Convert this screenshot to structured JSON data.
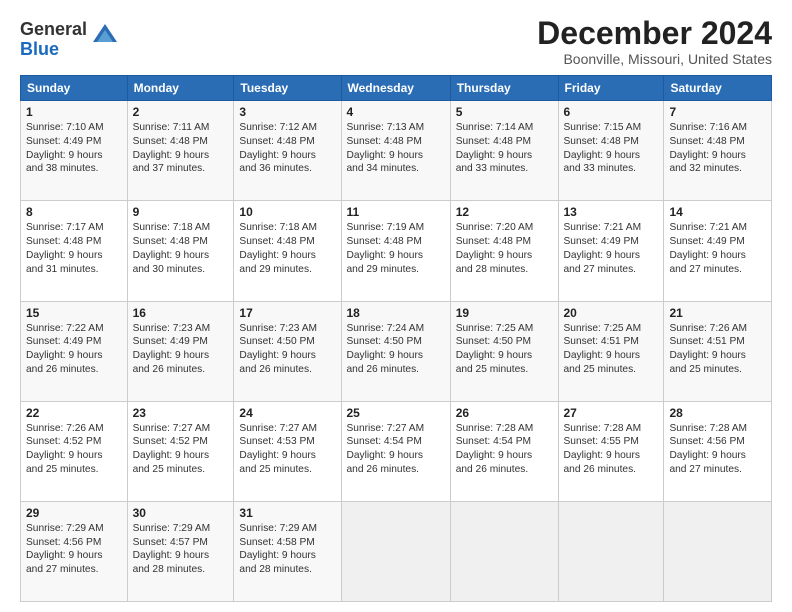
{
  "logo": {
    "general": "General",
    "blue": "Blue"
  },
  "header": {
    "title": "December 2024",
    "subtitle": "Boonville, Missouri, United States"
  },
  "days": [
    "Sunday",
    "Monday",
    "Tuesday",
    "Wednesday",
    "Thursday",
    "Friday",
    "Saturday"
  ],
  "weeks": [
    [
      {
        "num": "1",
        "info": "Sunrise: 7:10 AM\nSunset: 4:49 PM\nDaylight: 9 hours\nand 38 minutes."
      },
      {
        "num": "2",
        "info": "Sunrise: 7:11 AM\nSunset: 4:48 PM\nDaylight: 9 hours\nand 37 minutes."
      },
      {
        "num": "3",
        "info": "Sunrise: 7:12 AM\nSunset: 4:48 PM\nDaylight: 9 hours\nand 36 minutes."
      },
      {
        "num": "4",
        "info": "Sunrise: 7:13 AM\nSunset: 4:48 PM\nDaylight: 9 hours\nand 34 minutes."
      },
      {
        "num": "5",
        "info": "Sunrise: 7:14 AM\nSunset: 4:48 PM\nDaylight: 9 hours\nand 33 minutes."
      },
      {
        "num": "6",
        "info": "Sunrise: 7:15 AM\nSunset: 4:48 PM\nDaylight: 9 hours\nand 33 minutes."
      },
      {
        "num": "7",
        "info": "Sunrise: 7:16 AM\nSunset: 4:48 PM\nDaylight: 9 hours\nand 32 minutes."
      }
    ],
    [
      {
        "num": "8",
        "info": "Sunrise: 7:17 AM\nSunset: 4:48 PM\nDaylight: 9 hours\nand 31 minutes."
      },
      {
        "num": "9",
        "info": "Sunrise: 7:18 AM\nSunset: 4:48 PM\nDaylight: 9 hours\nand 30 minutes."
      },
      {
        "num": "10",
        "info": "Sunrise: 7:18 AM\nSunset: 4:48 PM\nDaylight: 9 hours\nand 29 minutes."
      },
      {
        "num": "11",
        "info": "Sunrise: 7:19 AM\nSunset: 4:48 PM\nDaylight: 9 hours\nand 29 minutes."
      },
      {
        "num": "12",
        "info": "Sunrise: 7:20 AM\nSunset: 4:48 PM\nDaylight: 9 hours\nand 28 minutes."
      },
      {
        "num": "13",
        "info": "Sunrise: 7:21 AM\nSunset: 4:49 PM\nDaylight: 9 hours\nand 27 minutes."
      },
      {
        "num": "14",
        "info": "Sunrise: 7:21 AM\nSunset: 4:49 PM\nDaylight: 9 hours\nand 27 minutes."
      }
    ],
    [
      {
        "num": "15",
        "info": "Sunrise: 7:22 AM\nSunset: 4:49 PM\nDaylight: 9 hours\nand 26 minutes."
      },
      {
        "num": "16",
        "info": "Sunrise: 7:23 AM\nSunset: 4:49 PM\nDaylight: 9 hours\nand 26 minutes."
      },
      {
        "num": "17",
        "info": "Sunrise: 7:23 AM\nSunset: 4:50 PM\nDaylight: 9 hours\nand 26 minutes."
      },
      {
        "num": "18",
        "info": "Sunrise: 7:24 AM\nSunset: 4:50 PM\nDaylight: 9 hours\nand 26 minutes."
      },
      {
        "num": "19",
        "info": "Sunrise: 7:25 AM\nSunset: 4:50 PM\nDaylight: 9 hours\nand 25 minutes."
      },
      {
        "num": "20",
        "info": "Sunrise: 7:25 AM\nSunset: 4:51 PM\nDaylight: 9 hours\nand 25 minutes."
      },
      {
        "num": "21",
        "info": "Sunrise: 7:26 AM\nSunset: 4:51 PM\nDaylight: 9 hours\nand 25 minutes."
      }
    ],
    [
      {
        "num": "22",
        "info": "Sunrise: 7:26 AM\nSunset: 4:52 PM\nDaylight: 9 hours\nand 25 minutes."
      },
      {
        "num": "23",
        "info": "Sunrise: 7:27 AM\nSunset: 4:52 PM\nDaylight: 9 hours\nand 25 minutes."
      },
      {
        "num": "24",
        "info": "Sunrise: 7:27 AM\nSunset: 4:53 PM\nDaylight: 9 hours\nand 25 minutes."
      },
      {
        "num": "25",
        "info": "Sunrise: 7:27 AM\nSunset: 4:54 PM\nDaylight: 9 hours\nand 26 minutes."
      },
      {
        "num": "26",
        "info": "Sunrise: 7:28 AM\nSunset: 4:54 PM\nDaylight: 9 hours\nand 26 minutes."
      },
      {
        "num": "27",
        "info": "Sunrise: 7:28 AM\nSunset: 4:55 PM\nDaylight: 9 hours\nand 26 minutes."
      },
      {
        "num": "28",
        "info": "Sunrise: 7:28 AM\nSunset: 4:56 PM\nDaylight: 9 hours\nand 27 minutes."
      }
    ],
    [
      {
        "num": "29",
        "info": "Sunrise: 7:29 AM\nSunset: 4:56 PM\nDaylight: 9 hours\nand 27 minutes."
      },
      {
        "num": "30",
        "info": "Sunrise: 7:29 AM\nSunset: 4:57 PM\nDaylight: 9 hours\nand 28 minutes."
      },
      {
        "num": "31",
        "info": "Sunrise: 7:29 AM\nSunset: 4:58 PM\nDaylight: 9 hours\nand 28 minutes."
      },
      null,
      null,
      null,
      null
    ]
  ]
}
